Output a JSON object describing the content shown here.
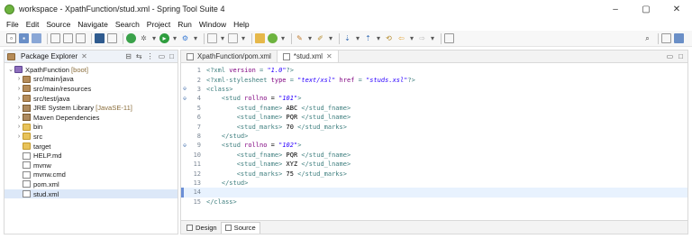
{
  "window": {
    "title": "workspace - XpathFunction/stud.xml - Spring Tool Suite 4",
    "controls": [
      "–",
      "▢",
      "✕"
    ]
  },
  "menu": [
    "File",
    "Edit",
    "Source",
    "Navigate",
    "Search",
    "Project",
    "Run",
    "Window",
    "Help"
  ],
  "package_explorer": {
    "title": "Package Explorer",
    "tree": [
      {
        "label": "XpathFunction",
        "suffix": "[boot]",
        "level": 0,
        "expanded": true,
        "icon": "project-icon"
      },
      {
        "label": "src/main/java",
        "suffix": "",
        "level": 1,
        "expanded": false,
        "icon": "package-folder-icon"
      },
      {
        "label": "src/main/resources",
        "suffix": "",
        "level": 1,
        "expanded": false,
        "icon": "package-folder-icon"
      },
      {
        "label": "src/test/java",
        "suffix": "",
        "level": 1,
        "expanded": false,
        "icon": "package-folder-icon"
      },
      {
        "label": "JRE System Library",
        "suffix": "[JavaSE-11]",
        "level": 1,
        "expanded": false,
        "icon": "library-icon"
      },
      {
        "label": "Maven Dependencies",
        "suffix": "",
        "level": 1,
        "expanded": false,
        "icon": "library-icon"
      },
      {
        "label": "bin",
        "suffix": "",
        "level": 1,
        "expanded": false,
        "icon": "folder-icon"
      },
      {
        "label": "src",
        "suffix": "",
        "level": 1,
        "expanded": false,
        "icon": "folder-icon"
      },
      {
        "label": "target",
        "suffix": "",
        "level": 1,
        "expanded": null,
        "icon": "folder-icon"
      },
      {
        "label": "HELP.md",
        "suffix": "",
        "level": 1,
        "expanded": null,
        "icon": "file-icon"
      },
      {
        "label": "mvnw",
        "suffix": "",
        "level": 1,
        "expanded": null,
        "icon": "file-icon"
      },
      {
        "label": "mvnw.cmd",
        "suffix": "",
        "level": 1,
        "expanded": null,
        "icon": "file-icon"
      },
      {
        "label": "pom.xml",
        "suffix": "",
        "level": 1,
        "expanded": null,
        "icon": "xml-file-icon"
      },
      {
        "label": "stud.xml",
        "suffix": "",
        "level": 1,
        "expanded": null,
        "icon": "xml-file-icon",
        "selected": true
      }
    ]
  },
  "editor": {
    "tabs": [
      {
        "label": "XpathFunction/pom.xml",
        "active": false
      },
      {
        "label": "*stud.xml",
        "active": true
      }
    ],
    "bottom_tabs": [
      {
        "label": "Design",
        "active": false
      },
      {
        "label": "Source",
        "active": true
      }
    ],
    "lines": [
      {
        "n": "1",
        "fold": "",
        "parts": [
          [
            "pi",
            "<?xml "
          ],
          [
            "attr",
            "version"
          ],
          [
            "pi",
            " = "
          ],
          [
            "val",
            "\"1.0\""
          ],
          [
            "pi",
            "?>"
          ]
        ]
      },
      {
        "n": "2",
        "fold": "",
        "parts": [
          [
            "pi",
            "<?xml-stylesheet "
          ],
          [
            "attr",
            "type"
          ],
          [
            "pi",
            " = "
          ],
          [
            "val",
            "\"text/xsl\""
          ],
          [
            "pi",
            " "
          ],
          [
            "attr",
            "href"
          ],
          [
            "pi",
            " = "
          ],
          [
            "val",
            "\"studs.xsl\""
          ],
          [
            "pi",
            "?>"
          ]
        ]
      },
      {
        "n": "3",
        "fold": "⊖",
        "parts": [
          [
            "tag",
            "<class>"
          ]
        ]
      },
      {
        "n": "4",
        "fold": "⊖",
        "parts": [
          [
            "text",
            "    "
          ],
          [
            "tag",
            "<stud "
          ],
          [
            "attr",
            "rollno"
          ],
          [
            "text",
            " = "
          ],
          [
            "val",
            "\"101\""
          ],
          [
            "tag",
            ">"
          ]
        ]
      },
      {
        "n": "5",
        "fold": "",
        "parts": [
          [
            "text",
            "        "
          ],
          [
            "tag",
            "<stud_fname>"
          ],
          [
            "text",
            " ABC "
          ],
          [
            "tag",
            "</stud_fname>"
          ]
        ]
      },
      {
        "n": "6",
        "fold": "",
        "parts": [
          [
            "text",
            "        "
          ],
          [
            "tag",
            "<stud_lname>"
          ],
          [
            "text",
            " PQR "
          ],
          [
            "tag",
            "</stud_lname>"
          ]
        ]
      },
      {
        "n": "7",
        "fold": "",
        "parts": [
          [
            "text",
            "        "
          ],
          [
            "tag",
            "<stud_marks>"
          ],
          [
            "text",
            " 70 "
          ],
          [
            "tag",
            "</stud_marks>"
          ]
        ]
      },
      {
        "n": "8",
        "fold": "",
        "parts": [
          [
            "text",
            "    "
          ],
          [
            "tag",
            "</stud>"
          ]
        ]
      },
      {
        "n": "9",
        "fold": "⊖",
        "parts": [
          [
            "text",
            "    "
          ],
          [
            "tag",
            "<stud "
          ],
          [
            "attr",
            "rollno"
          ],
          [
            "text",
            " = "
          ],
          [
            "val",
            "\"102\""
          ],
          [
            "tag",
            ">"
          ]
        ]
      },
      {
        "n": "10",
        "fold": "",
        "parts": [
          [
            "text",
            "        "
          ],
          [
            "tag",
            "<stud_fname>"
          ],
          [
            "text",
            " PQR "
          ],
          [
            "tag",
            "</stud_fname>"
          ]
        ]
      },
      {
        "n": "11",
        "fold": "",
        "parts": [
          [
            "text",
            "        "
          ],
          [
            "tag",
            "<stud_lname>"
          ],
          [
            "text",
            " XYZ "
          ],
          [
            "tag",
            "</stud_lname>"
          ]
        ]
      },
      {
        "n": "12",
        "fold": "",
        "parts": [
          [
            "text",
            "        "
          ],
          [
            "tag",
            "<stud_marks>"
          ],
          [
            "text",
            " 75 "
          ],
          [
            "tag",
            "</stud_marks>"
          ]
        ]
      },
      {
        "n": "13",
        "fold": "",
        "parts": [
          [
            "text",
            "    "
          ],
          [
            "tag",
            "</stud>"
          ]
        ]
      },
      {
        "n": "14",
        "fold": "",
        "parts": [
          [
            "text",
            "    "
          ]
        ],
        "current": true
      },
      {
        "n": "15",
        "fold": "",
        "parts": [
          [
            "tag",
            "</class>"
          ]
        ]
      }
    ]
  },
  "colors": {
    "tag": "#3f7f7f",
    "attribute": "#7f007f",
    "value": "#2a00ff",
    "current_line": "#e8f2fe",
    "selection": "#dce8f8"
  }
}
